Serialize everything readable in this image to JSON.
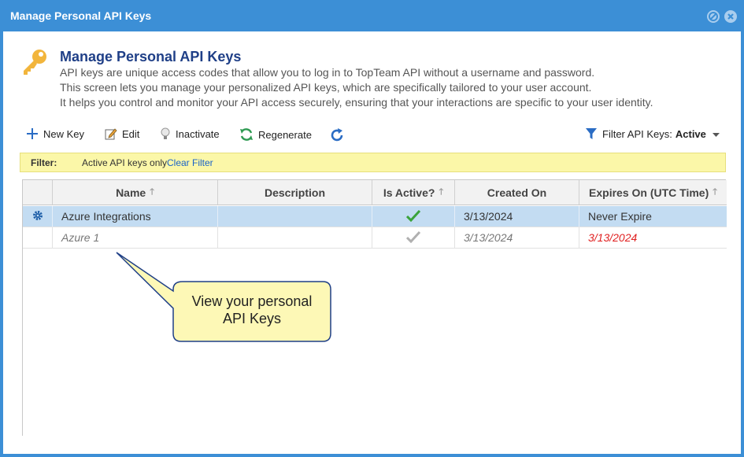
{
  "window": {
    "title": "Manage Personal API Keys"
  },
  "header": {
    "title": "Manage Personal API Keys",
    "lines": [
      "API keys are unique access codes that allow you to log in to TopTeam API without a username and password.",
      "This screen lets you manage your personalized API keys, which are specifically tailored to your user account.",
      "It helps you control and monitor your API access securely, ensuring that your interactions are specific to your user identity."
    ]
  },
  "toolbar": {
    "new_key": "New Key",
    "edit": "Edit",
    "inactivate": "Inactivate",
    "regenerate": "Regenerate",
    "filter_label": "Filter API Keys:",
    "filter_value": "Active"
  },
  "filter_bar": {
    "label": "Filter:",
    "value": "Active API keys only",
    "clear": "Clear Filter"
  },
  "grid": {
    "columns": [
      "Name",
      "Description",
      "Is Active?",
      "Created On",
      "Expires On (UTC Time)"
    ],
    "rows": [
      {
        "name": "Azure Integrations",
        "description": "",
        "created_on": "3/13/2024",
        "expires_on": "Never Expire",
        "active": true
      },
      {
        "name": "Azure 1",
        "description": "",
        "created_on": "3/13/2024",
        "expires_on": "3/13/2024",
        "active": false
      }
    ]
  },
  "callout": {
    "line1": "View your personal",
    "line2": "API Keys"
  },
  "colors": {
    "titlebar": "#3c8fd6",
    "accent": "#1f3f87",
    "selected_row": "#c3dcf2",
    "filter_bg": "#fbf7a8",
    "expired": "#e02020"
  }
}
